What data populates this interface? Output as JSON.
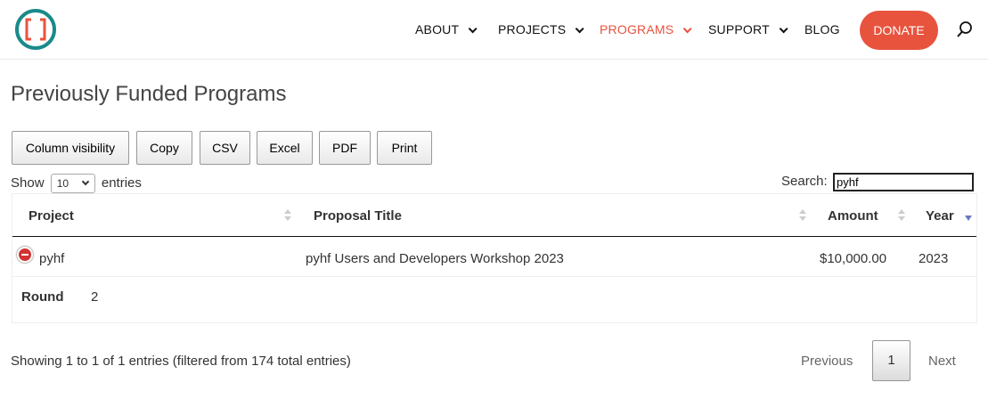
{
  "header": {
    "nav": [
      {
        "label": "ABOUT",
        "has_dropdown": true,
        "active": false
      },
      {
        "label": "PROJECTS",
        "has_dropdown": true,
        "active": false
      },
      {
        "label": "PROGRAMS",
        "has_dropdown": true,
        "active": true
      },
      {
        "label": "SUPPORT",
        "has_dropdown": true,
        "active": false
      },
      {
        "label": "BLOG",
        "has_dropdown": false,
        "active": false
      }
    ],
    "donate_label": "DONATE",
    "logo_icon": "brackets-logo-icon",
    "search_icon": "search-icon"
  },
  "page_title": "Previously Funded Programs",
  "buttons": {
    "column_visibility": "Column visibility",
    "copy": "Copy",
    "csv": "CSV",
    "excel": "Excel",
    "pdf": "PDF",
    "print": "Print"
  },
  "length": {
    "show_label": "Show",
    "value": "10",
    "entries_label": "entries"
  },
  "search": {
    "label": "Search:",
    "value": "pyhf"
  },
  "table": {
    "headers": {
      "project": "Project",
      "proposal_title": "Proposal Title",
      "amount": "Amount",
      "year": "Year"
    },
    "rows": [
      {
        "project": "pyhf",
        "proposal_title": "pyhf Users and Developers Workshop 2023",
        "amount": "$10,000.00",
        "year": "2023",
        "details": {
          "label": "Round",
          "value": "2"
        }
      }
    ]
  },
  "footer": {
    "info": "Showing 1 to 1 of 1 entries (filtered from 174 total entries)",
    "pagination": {
      "previous": "Previous",
      "current": "1",
      "next": "Next"
    }
  },
  "colors": {
    "accent": "#e8533e",
    "logo_ring": "#1a8a8a",
    "sort_active": "#6a79c6",
    "remove_button": "#d33333"
  }
}
